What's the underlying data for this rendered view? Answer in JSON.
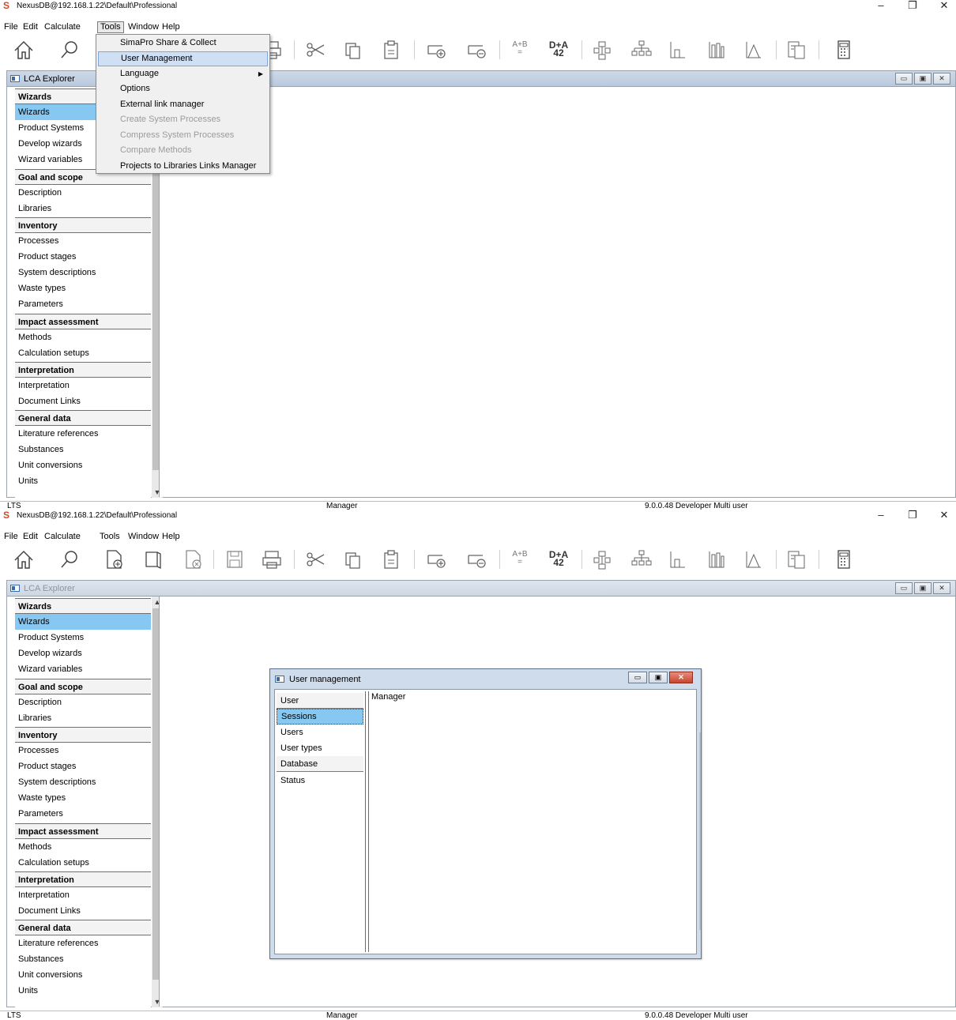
{
  "window": {
    "title": "NexusDB@192.168.1.22\\Default\\Professional",
    "logo_glyph": "S",
    "minimize": "–",
    "restore": "❐",
    "close": "✕"
  },
  "menubar": {
    "items": [
      {
        "label": "File",
        "underline": "F"
      },
      {
        "label": "Edit",
        "underline": "E"
      },
      {
        "label": "Calculate",
        "underline": "C"
      },
      {
        "label": "Tools",
        "underline": "T"
      },
      {
        "label": "Window",
        "underline": "W"
      },
      {
        "label": "Help",
        "underline": "H"
      }
    ]
  },
  "toolbar": {
    "ab_label_top": "A+B",
    "ab_label_bottom": "=",
    "da_label_top": "D+A",
    "da_label_bottom": "42"
  },
  "tools_menu": {
    "items": [
      {
        "label": "SimaPro Share & Collect",
        "disabled": false
      },
      {
        "label": "User Management",
        "disabled": false,
        "highlighted": true
      },
      {
        "label": "Language",
        "disabled": false,
        "submenu": true
      },
      {
        "label": "Options",
        "disabled": false
      },
      {
        "label": "External link manager",
        "disabled": false
      },
      {
        "label": "Create System Processes",
        "disabled": true
      },
      {
        "label": "Compress System Processes",
        "disabled": true
      },
      {
        "label": "Compare Methods",
        "disabled": true
      },
      {
        "label": "Projects to Libraries Links Manager",
        "disabled": false
      }
    ]
  },
  "explorer": {
    "title": "LCA Explorer",
    "min_glyph": "▭",
    "max_glyph": "▣",
    "close_glyph": "✕",
    "up_glyph": "▲",
    "down_glyph": "▼",
    "rows": [
      {
        "label": "Wizards",
        "kind": "head"
      },
      {
        "label": "Wizards",
        "kind": "sel"
      },
      {
        "label": "Product Systems",
        "kind": "item"
      },
      {
        "label": "Develop wizards",
        "kind": "item"
      },
      {
        "label": "Wizard variables",
        "kind": "item"
      },
      {
        "label": "Goal and scope",
        "kind": "head"
      },
      {
        "label": "Description",
        "kind": "item"
      },
      {
        "label": "Libraries",
        "kind": "item"
      },
      {
        "label": "Inventory",
        "kind": "head"
      },
      {
        "label": "Processes",
        "kind": "item"
      },
      {
        "label": "Product stages",
        "kind": "item"
      },
      {
        "label": "System descriptions",
        "kind": "item"
      },
      {
        "label": "Waste types",
        "kind": "item"
      },
      {
        "label": "Parameters",
        "kind": "item"
      },
      {
        "label": "Impact assessment",
        "kind": "head"
      },
      {
        "label": "Methods",
        "kind": "item"
      },
      {
        "label": "Calculation setups",
        "kind": "item"
      },
      {
        "label": "Interpretation",
        "kind": "head"
      },
      {
        "label": "Interpretation",
        "kind": "item"
      },
      {
        "label": "Document Links",
        "kind": "item"
      },
      {
        "label": "General data",
        "kind": "head"
      },
      {
        "label": "Literature references",
        "kind": "item"
      },
      {
        "label": "Substances",
        "kind": "item"
      },
      {
        "label": "Unit conversions",
        "kind": "item"
      },
      {
        "label": "Units",
        "kind": "item"
      }
    ]
  },
  "statusbar": {
    "left": "LTS",
    "user": "Manager",
    "version": "9.0.0.48 Developer Multi user"
  },
  "user_management": {
    "title": "User management",
    "min_glyph": "▭",
    "max_glyph": "▣",
    "close_glyph": "✕",
    "nav": [
      {
        "label": "User",
        "kind": "head"
      },
      {
        "label": "Sessions",
        "kind": "sel"
      },
      {
        "label": "Users",
        "kind": "item"
      },
      {
        "label": "User types",
        "kind": "item"
      },
      {
        "label": "Database",
        "kind": "head"
      },
      {
        "label": "Status",
        "kind": "item"
      }
    ],
    "content_value": "Manager"
  },
  "colors": {
    "selection": "#86c8f2",
    "title_gradient": "#cdd9e8",
    "close_red": "#c8462f"
  }
}
